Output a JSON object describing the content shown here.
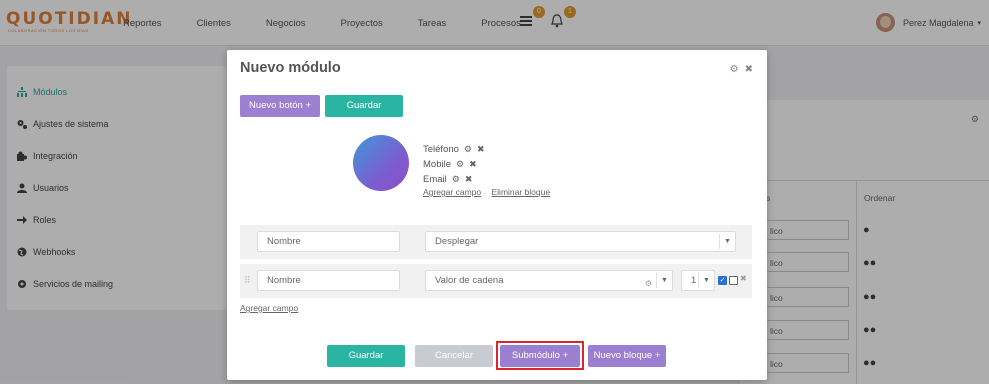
{
  "app": {
    "logo_text": "QUOTIDIAN",
    "logo_tagline": "COLABORACIÓN TODOS LOS DÍAS"
  },
  "nav": {
    "items": [
      "Reportes",
      "Clientes",
      "Negocios",
      "Proyectos",
      "Tareas",
      "Procesos"
    ]
  },
  "notifications": {
    "messages_count": "0",
    "alerts_count": "1"
  },
  "user": {
    "name": "Perez Magdalena",
    "caret": "▾"
  },
  "sidebar": {
    "items": [
      {
        "label": "Módulos",
        "icon": "sitemap-icon"
      },
      {
        "label": "Ajustes de sistema",
        "icon": "gears-icon"
      },
      {
        "label": "Integración",
        "icon": "puzzle-icon"
      },
      {
        "label": "Usuarios",
        "icon": "user-icon"
      },
      {
        "label": "Roles",
        "icon": "arrow-right-icon"
      },
      {
        "label": "Webhooks",
        "icon": "globe-icon"
      },
      {
        "label": "Servicios de mailing",
        "icon": "gear-icon"
      }
    ]
  },
  "background_table": {
    "col_partial": "s",
    "col_order": "Ordenar",
    "cell_text": "lico"
  },
  "modal": {
    "title": "Nuevo módulo",
    "btn_new_button": "Nuevo botón +",
    "btn_save_top": "Guardar",
    "block_fields": [
      "Teléfono",
      "Mobile",
      "Email"
    ],
    "link_add_field_block": "Agregar campo",
    "link_delete_block": "Eliminar bloque",
    "row1": {
      "name_placeholder": "Nombre",
      "type_value": "Desplegar"
    },
    "row2": {
      "name_placeholder": "Nombre",
      "type_value": "Valor de cadena",
      "number_value": "1"
    },
    "link_add_field": "Agregar campo",
    "footer": {
      "save": "Guardar",
      "cancel": "Cancelar",
      "submodule": "Submódulo +",
      "new_block": "Nuevo bloque +"
    }
  },
  "colors": {
    "teal": "#2ab5a3",
    "purple": "#9b7fd1",
    "accent_orange": "#e2803a",
    "highlight": "#d8262c"
  }
}
